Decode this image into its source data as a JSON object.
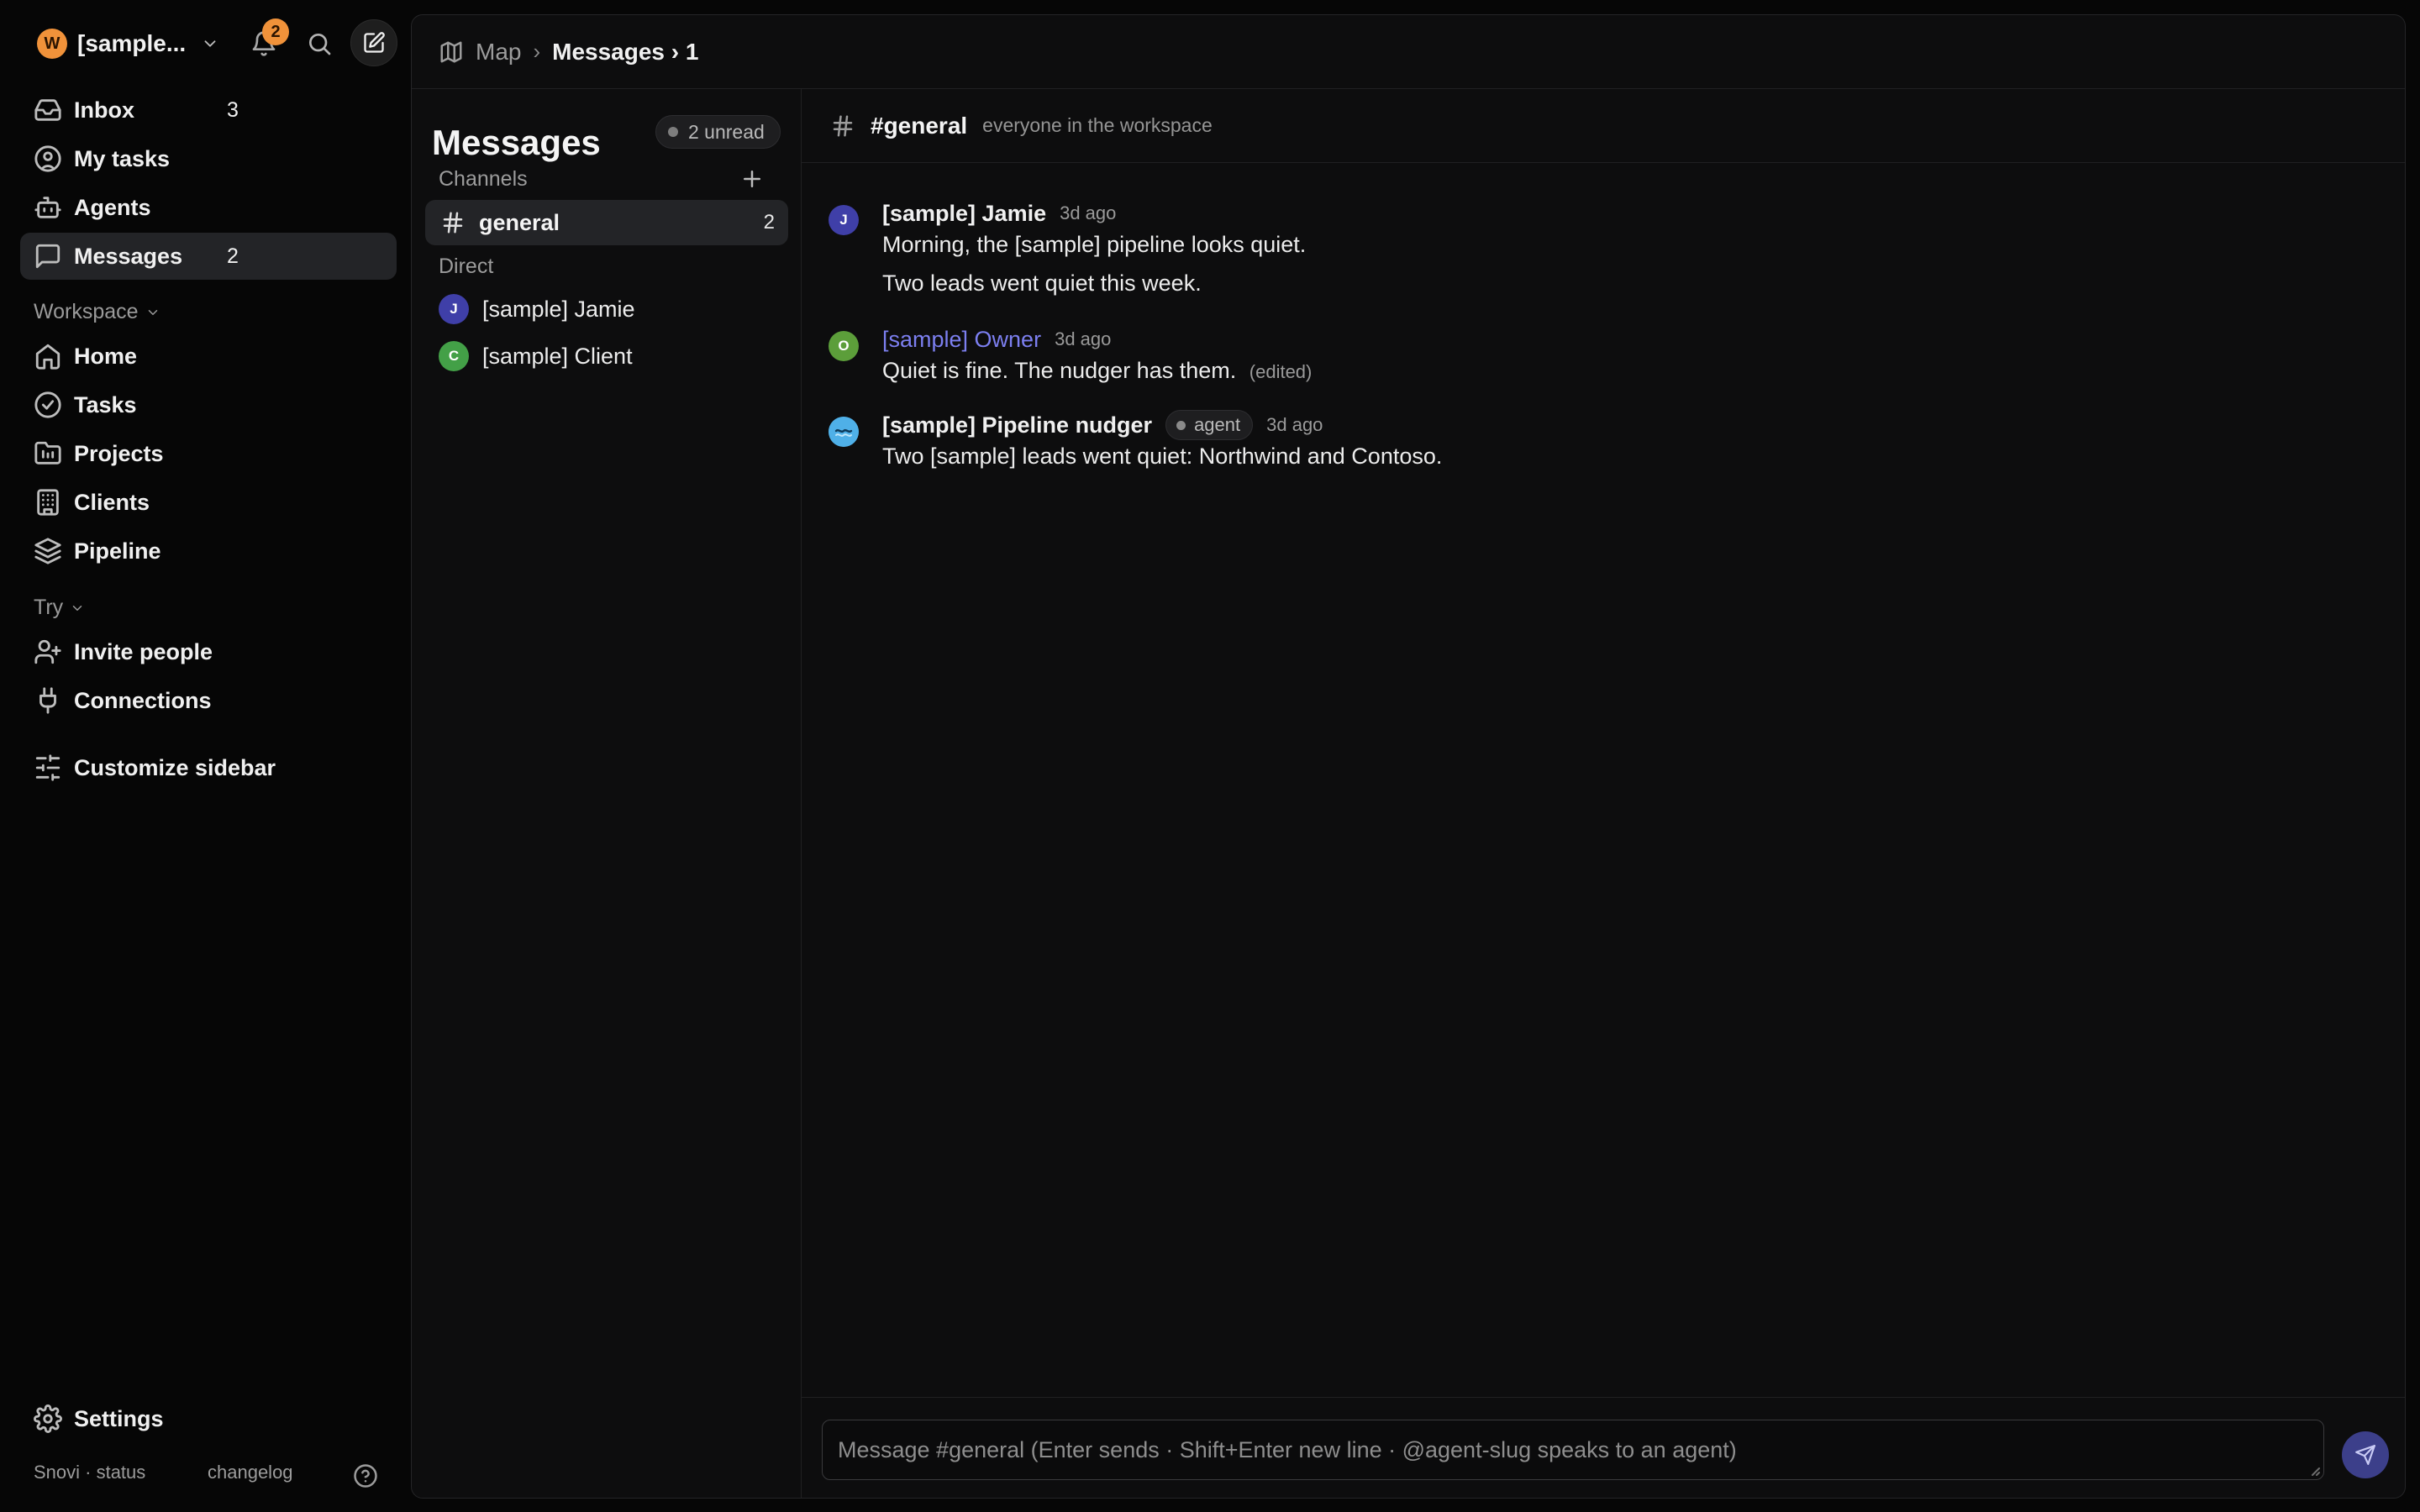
{
  "workspace": {
    "avatar_letter": "W",
    "name": "[sample...",
    "notifications": "2"
  },
  "sidebar": {
    "primary": [
      {
        "label": "Inbox",
        "count": "3",
        "icon": "inbox-icon"
      },
      {
        "label": "My tasks",
        "count": "",
        "icon": "user-circle-icon"
      },
      {
        "label": "Agents",
        "count": "",
        "icon": "robot-icon"
      },
      {
        "label": "Messages",
        "count": "2",
        "icon": "message-icon",
        "active": true
      }
    ],
    "workspace_section": {
      "title": "Workspace",
      "items": [
        {
          "label": "Home",
          "icon": "home-icon"
        },
        {
          "label": "Tasks",
          "icon": "check-circle-icon"
        },
        {
          "label": "Projects",
          "icon": "folder-icon"
        },
        {
          "label": "Clients",
          "icon": "building-icon"
        },
        {
          "label": "Pipeline",
          "icon": "layers-icon"
        }
      ]
    },
    "try_section": {
      "title": "Try",
      "items": [
        {
          "label": "Invite people",
          "icon": "user-plus-icon"
        },
        {
          "label": "Connections",
          "icon": "plug-icon"
        }
      ]
    },
    "customize": "Customize sidebar",
    "settings": "Settings",
    "footer": {
      "status": "Snovi · status",
      "changelog": "changelog"
    }
  },
  "breadcrumb": {
    "root": "Map",
    "separator": "›",
    "current": "Messages › 1"
  },
  "messages_panel": {
    "title": "Messages",
    "unread_badge": "2 unread",
    "channels_label": "Channels",
    "channels": [
      {
        "name": "general",
        "count": "2"
      }
    ],
    "direct_label": "Direct",
    "direct": [
      {
        "name": "[sample] Jamie",
        "initial": "J",
        "color": "#3f3fa8"
      },
      {
        "name": "[sample] Client",
        "initial": "C",
        "color": "#43a047"
      }
    ]
  },
  "channel": {
    "name": "#general",
    "description": "everyone in the workspace"
  },
  "thread": [
    {
      "author": "[sample] Jamie",
      "initial": "J",
      "color": "#3f3fa8",
      "time": "3d ago",
      "lines": [
        "Morning, the [sample] pipeline looks quiet.",
        "Two leads went quiet this week."
      ]
    },
    {
      "author": "[sample] Owner",
      "initial": "O",
      "color": "#5c9e3a",
      "time": "3d ago",
      "lines": [
        "Quiet is fine. The nudger has them."
      ],
      "edited": "(edited)"
    },
    {
      "author": "[sample] Pipeline nudger",
      "tag": "agent",
      "time": "3d ago",
      "lines": [
        "Two [sample] leads went quiet: Northwind and Contoso."
      ]
    }
  ],
  "composer": {
    "placeholder": "Message #general (Enter sends · Shift+Enter new line · @agent-slug speaks to an agent)"
  },
  "colors": {
    "accent": "#f0923a",
    "owner_name": "#7c7ff0",
    "send_button": "#3c3f8a"
  }
}
